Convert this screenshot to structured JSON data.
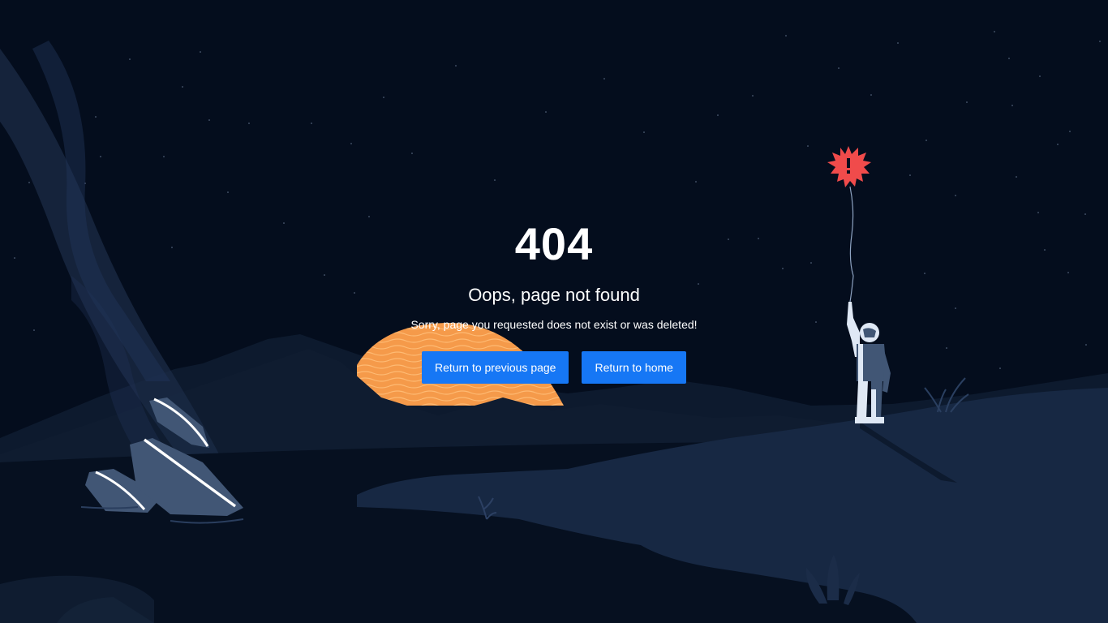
{
  "error": {
    "code": "404",
    "title": "Oops, page not found",
    "description": "Sorry, page you requested does not exist or was deleted!"
  },
  "actions": {
    "back_label": "Return to previous page",
    "home_label": "Return to home"
  },
  "colors": {
    "background": "#040d1d",
    "accent": "#1677f5",
    "sun": "#f59a4a",
    "alert_balloon": "#f04b4b"
  },
  "icons": {
    "balloon": "exclamation-balloon-icon"
  }
}
